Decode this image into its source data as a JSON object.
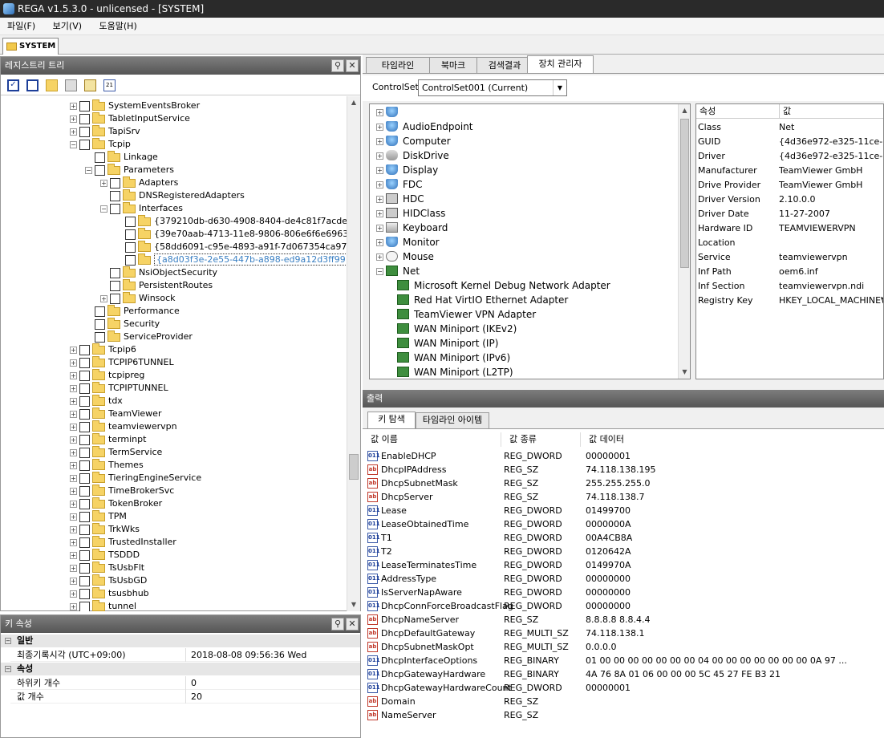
{
  "window": {
    "title": "REGA v1.5.3.0 - unlicensed - [SYSTEM]"
  },
  "menu": [
    "파일(F)",
    "보기(V)",
    "도움말(H)"
  ],
  "doc_tab": "SYSTEM",
  "tree_panel": {
    "title": "레지스트리 트리",
    "rows": [
      {
        "label": "SystemEventsBroker",
        "level": 0,
        "exp": "+"
      },
      {
        "label": "TabletInputService",
        "level": 0,
        "exp": "+"
      },
      {
        "label": "TapiSrv",
        "level": 0,
        "exp": "+"
      },
      {
        "label": "Tcpip",
        "level": 0,
        "exp": "-"
      },
      {
        "label": "Linkage",
        "level": 1,
        "exp": ""
      },
      {
        "label": "Parameters",
        "level": 1,
        "exp": "-"
      },
      {
        "label": "Adapters",
        "level": 2,
        "exp": "+"
      },
      {
        "label": "DNSRegisteredAdapters",
        "level": 2,
        "exp": ""
      },
      {
        "label": "Interfaces",
        "level": 2,
        "exp": "-"
      },
      {
        "label": "{379210db-d630-4908-8404-de4c81f7acde}",
        "level": 3,
        "exp": ""
      },
      {
        "label": "{39e70aab-4713-11e8-9806-806e6f6e6963}",
        "level": 3,
        "exp": ""
      },
      {
        "label": "{58dd6091-c95e-4893-a91f-7d067354ca97}",
        "level": 3,
        "exp": ""
      },
      {
        "label": "{a8d03f3e-2e55-447b-a898-ed9a12d3ff99}",
        "level": 3,
        "exp": "",
        "selected": true
      },
      {
        "label": "NsiObjectSecurity",
        "level": 2,
        "exp": ""
      },
      {
        "label": "PersistentRoutes",
        "level": 2,
        "exp": ""
      },
      {
        "label": "Winsock",
        "level": 2,
        "exp": "+"
      },
      {
        "label": "Performance",
        "level": 1,
        "exp": ""
      },
      {
        "label": "Security",
        "level": 1,
        "exp": ""
      },
      {
        "label": "ServiceProvider",
        "level": 1,
        "exp": ""
      },
      {
        "label": "Tcpip6",
        "level": 0,
        "exp": "+"
      },
      {
        "label": "TCPIP6TUNNEL",
        "level": 0,
        "exp": "+"
      },
      {
        "label": "tcpipreg",
        "level": 0,
        "exp": "+"
      },
      {
        "label": "TCPIPTUNNEL",
        "level": 0,
        "exp": "+"
      },
      {
        "label": "tdx",
        "level": 0,
        "exp": "+"
      },
      {
        "label": "TeamViewer",
        "level": 0,
        "exp": "+"
      },
      {
        "label": "teamviewervpn",
        "level": 0,
        "exp": "+"
      },
      {
        "label": "terminpt",
        "level": 0,
        "exp": "+"
      },
      {
        "label": "TermService",
        "level": 0,
        "exp": "+"
      },
      {
        "label": "Themes",
        "level": 0,
        "exp": "+"
      },
      {
        "label": "TieringEngineService",
        "level": 0,
        "exp": "+"
      },
      {
        "label": "TimeBrokerSvc",
        "level": 0,
        "exp": "+"
      },
      {
        "label": "TokenBroker",
        "level": 0,
        "exp": "+"
      },
      {
        "label": "TPM",
        "level": 0,
        "exp": "+"
      },
      {
        "label": "TrkWks",
        "level": 0,
        "exp": "+"
      },
      {
        "label": "TrustedInstaller",
        "level": 0,
        "exp": "+"
      },
      {
        "label": "TSDDD",
        "level": 0,
        "exp": "+"
      },
      {
        "label": "TsUsbFlt",
        "level": 0,
        "exp": "+"
      },
      {
        "label": "TsUsbGD",
        "level": 0,
        "exp": "+"
      },
      {
        "label": "tsusbhub",
        "level": 0,
        "exp": "+"
      },
      {
        "label": "tunnel",
        "level": 0,
        "exp": "+"
      }
    ]
  },
  "key_props": {
    "title": "키 속성",
    "group_general": "일반",
    "group_props": "속성",
    "rows": [
      {
        "k": "최종기록시각 (UTC+09:00)",
        "v": "2018-08-08  09:56:36  Wed"
      },
      {
        "k": "하위키 개수",
        "v": "0"
      },
      {
        "k": "값 개수",
        "v": "20"
      }
    ]
  },
  "right_tabs": [
    "타임라인",
    "북마크",
    "검색결과",
    "장치 관리자"
  ],
  "controlset": {
    "label": "ControlSet",
    "value": "ControlSet001 (Current)"
  },
  "devices": [
    {
      "label": "",
      "icon": "generic",
      "level": 0,
      "exp": "+"
    },
    {
      "label": "AudioEndpoint",
      "icon": "generic",
      "level": 0,
      "exp": "+"
    },
    {
      "label": "Computer",
      "icon": "generic",
      "level": 0,
      "exp": "+"
    },
    {
      "label": "DiskDrive",
      "icon": "disk",
      "level": 0,
      "exp": "+"
    },
    {
      "label": "Display",
      "icon": "generic",
      "level": 0,
      "exp": "+"
    },
    {
      "label": "FDC",
      "icon": "generic",
      "level": 0,
      "exp": "+"
    },
    {
      "label": "HDC",
      "icon": "hid",
      "level": 0,
      "exp": "+"
    },
    {
      "label": "HIDClass",
      "icon": "hid",
      "level": 0,
      "exp": "+"
    },
    {
      "label": "Keyboard",
      "icon": "key",
      "level": 0,
      "exp": "+"
    },
    {
      "label": "Monitor",
      "icon": "generic",
      "level": 0,
      "exp": "+"
    },
    {
      "label": "Mouse",
      "icon": "mouse",
      "level": 0,
      "exp": "+"
    },
    {
      "label": "Net",
      "icon": "net",
      "level": 0,
      "exp": "-"
    },
    {
      "label": "Microsoft Kernel Debug Network Adapter",
      "icon": "net",
      "level": 1,
      "exp": ""
    },
    {
      "label": "Red Hat VirtIO Ethernet Adapter",
      "icon": "net",
      "level": 1,
      "exp": ""
    },
    {
      "label": "TeamViewer VPN Adapter",
      "icon": "net",
      "level": 1,
      "exp": ""
    },
    {
      "label": "WAN Miniport (IKEv2)",
      "icon": "net",
      "level": 1,
      "exp": ""
    },
    {
      "label": "WAN Miniport (IP)",
      "icon": "net",
      "level": 1,
      "exp": ""
    },
    {
      "label": "WAN Miniport (IPv6)",
      "icon": "net",
      "level": 1,
      "exp": ""
    },
    {
      "label": "WAN Miniport (L2TP)",
      "icon": "net",
      "level": 1,
      "exp": ""
    }
  ],
  "device_props": {
    "headers": [
      "속성",
      "값"
    ],
    "rows": [
      {
        "k": "Class",
        "v": "Net"
      },
      {
        "k": "GUID",
        "v": "{4d36e972-e325-11ce-bfc1"
      },
      {
        "k": "Driver",
        "v": "{4d36e972-e325-11ce-bfc1"
      },
      {
        "k": "Manufacturer",
        "v": "TeamViewer GmbH"
      },
      {
        "k": "Drive Provider",
        "v": "TeamViewer GmbH"
      },
      {
        "k": "Driver Version",
        "v": "2.10.0.0"
      },
      {
        "k": "Driver Date",
        "v": "11-27-2007"
      },
      {
        "k": "Hardware ID",
        "v": "TEAMVIEWERVPN"
      },
      {
        "k": "Location",
        "v": ""
      },
      {
        "k": "Service",
        "v": "teamviewervpn"
      },
      {
        "k": "Inf Path",
        "v": "oem6.inf"
      },
      {
        "k": "Inf Section",
        "v": "teamviewervpn.ndi"
      },
      {
        "k": "Registry Key",
        "v": "HKEY_LOCAL_MACHINE₩S"
      }
    ]
  },
  "output": {
    "title": "출력",
    "tabs": [
      "키 탐색",
      "타임라인 아이템"
    ],
    "headers": [
      "값 이름",
      "값 종류",
      "값 데이터"
    ],
    "rows": [
      {
        "icon": "bin",
        "name": "EnableDHCP",
        "type": "REG_DWORD",
        "data": "00000001"
      },
      {
        "icon": "sz",
        "name": "DhcpIPAddress",
        "type": "REG_SZ",
        "data": "74.118.138.195"
      },
      {
        "icon": "sz",
        "name": "DhcpSubnetMask",
        "type": "REG_SZ",
        "data": "255.255.255.0"
      },
      {
        "icon": "sz",
        "name": "DhcpServer",
        "type": "REG_SZ",
        "data": "74.118.138.7"
      },
      {
        "icon": "bin",
        "name": "Lease",
        "type": "REG_DWORD",
        "data": "01499700"
      },
      {
        "icon": "bin",
        "name": "LeaseObtainedTime",
        "type": "REG_DWORD",
        "data": "0000000A"
      },
      {
        "icon": "bin",
        "name": "T1",
        "type": "REG_DWORD",
        "data": "00A4CB8A"
      },
      {
        "icon": "bin",
        "name": "T2",
        "type": "REG_DWORD",
        "data": "0120642A"
      },
      {
        "icon": "bin",
        "name": "LeaseTerminatesTime",
        "type": "REG_DWORD",
        "data": "0149970A"
      },
      {
        "icon": "bin",
        "name": "AddressType",
        "type": "REG_DWORD",
        "data": "00000000"
      },
      {
        "icon": "bin",
        "name": "IsServerNapAware",
        "type": "REG_DWORD",
        "data": "00000000"
      },
      {
        "icon": "bin",
        "name": "DhcpConnForceBroadcastFlag",
        "type": "REG_DWORD",
        "data": "00000000"
      },
      {
        "icon": "sz",
        "name": "DhcpNameServer",
        "type": "REG_SZ",
        "data": "8.8.8.8 8.8.4.4"
      },
      {
        "icon": "sz",
        "name": "DhcpDefaultGateway",
        "type": "REG_MULTI_SZ",
        "data": "74.118.138.1"
      },
      {
        "icon": "sz",
        "name": "DhcpSubnetMaskOpt",
        "type": "REG_MULTI_SZ",
        "data": "0.0.0.0"
      },
      {
        "icon": "bin",
        "name": "DhcpInterfaceOptions",
        "type": "REG_BINARY",
        "data": "01 00 00 00 00 00 00 00 04 00 00 00 00 00 00 00 0A 97 ..."
      },
      {
        "icon": "bin",
        "name": "DhcpGatewayHardware",
        "type": "REG_BINARY",
        "data": "4A 76 8A 01 06 00 00 00 5C 45 27 FE B3 21"
      },
      {
        "icon": "bin",
        "name": "DhcpGatewayHardwareCount",
        "type": "REG_DWORD",
        "data": "00000001"
      },
      {
        "icon": "sz",
        "name": "Domain",
        "type": "REG_SZ",
        "data": ""
      },
      {
        "icon": "sz",
        "name": "NameServer",
        "type": "REG_SZ",
        "data": ""
      }
    ]
  }
}
